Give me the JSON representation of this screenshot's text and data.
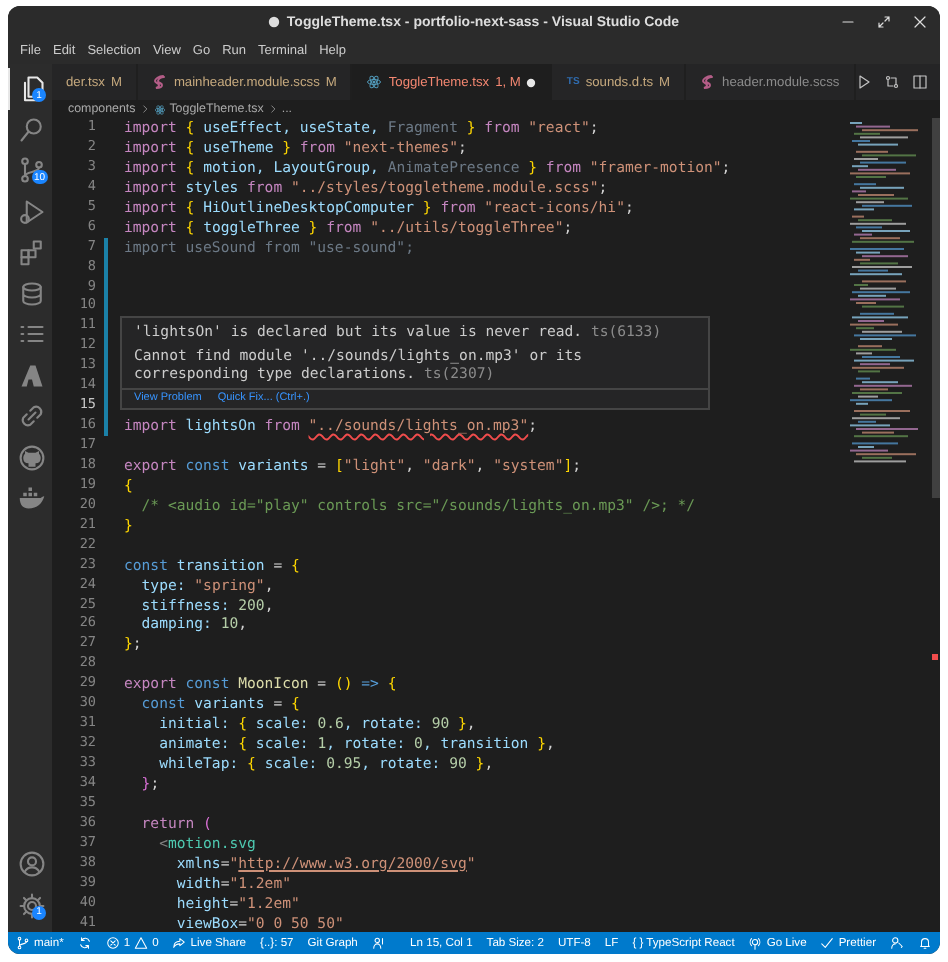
{
  "window": {
    "title": "ToggleTheme.tsx - portfolio-next-sass - Visual Studio Code",
    "dirty": true
  },
  "menu": [
    "File",
    "Edit",
    "Selection",
    "View",
    "Go",
    "Run",
    "Terminal",
    "Help"
  ],
  "activity_bar": {
    "items": [
      {
        "selected": true,
        "badge": "1"
      },
      {
        "selected": false
      },
      {
        "selected": false,
        "badge": "10"
      },
      {
        "selected": false
      },
      {
        "selected": false
      },
      {
        "selected": false
      },
      {
        "selected": false
      },
      {
        "selected": false
      },
      {
        "selected": false
      },
      {
        "selected": false
      },
      {
        "selected": false
      }
    ],
    "bottom_items": [
      {
        "selected": false
      },
      {
        "selected": false,
        "badge": "1"
      }
    ]
  },
  "tabs": [
    {
      "label": "der.tsx",
      "status": "M",
      "has_error": false,
      "selected": false,
      "dirty": false
    },
    {
      "label": "mainheader.module.scss",
      "kind": "sass",
      "status": "M",
      "has_error": false,
      "selected": false,
      "dirty": false
    },
    {
      "label": "ToggleTheme.tsx",
      "kind": "react",
      "status": "1, M",
      "has_error": true,
      "selected": true,
      "dirty": true
    },
    {
      "label": "sounds.d.ts",
      "kind": "typescript",
      "icon_text": "TS",
      "status": "M",
      "has_error": false,
      "selected": false,
      "dirty": false
    },
    {
      "label": "header.module.scss",
      "kind": "sass",
      "has_error": false,
      "selected": false,
      "dirty": false
    }
  ],
  "breadcrumb": [
    {
      "label": "components"
    },
    {
      "label": "ToggleTheme.tsx",
      "kind": "react"
    },
    {
      "label": "..."
    }
  ],
  "editor": {
    "lines": [
      {
        "number": "1",
        "modified": false,
        "current": false,
        "tokens": [
          {
            "text": "import ",
            "kind": "kw"
          },
          {
            "text": "{",
            "kind": "br"
          },
          {
            "text": " useEffect, useState, ",
            "kind": "var"
          },
          {
            "text": "Fragment ",
            "kind": "unused"
          },
          {
            "text": "}",
            "kind": "br"
          },
          {
            "text": " from ",
            "kind": "kw"
          },
          {
            "text": "\"react\"",
            "kind": "str"
          },
          {
            "text": ";",
            "kind": "p"
          }
        ]
      },
      {
        "number": "2",
        "modified": false,
        "current": false,
        "tokens": [
          {
            "text": "import ",
            "kind": "kw"
          },
          {
            "text": "{",
            "kind": "br"
          },
          {
            "text": " useTheme ",
            "kind": "var"
          },
          {
            "text": "}",
            "kind": "br"
          },
          {
            "text": " from ",
            "kind": "kw"
          },
          {
            "text": "\"next-themes\"",
            "kind": "str"
          },
          {
            "text": ";",
            "kind": "p"
          }
        ]
      },
      {
        "number": "3",
        "modified": false,
        "current": false,
        "tokens": [
          {
            "text": "import ",
            "kind": "kw"
          },
          {
            "text": "{",
            "kind": "br"
          },
          {
            "text": " motion, LayoutGroup, ",
            "kind": "var"
          },
          {
            "text": "AnimatePresence ",
            "kind": "unused"
          },
          {
            "text": "}",
            "kind": "br"
          },
          {
            "text": " from ",
            "kind": "kw"
          },
          {
            "text": "\"framer-motion\"",
            "kind": "str"
          },
          {
            "text": ";",
            "kind": "p"
          }
        ]
      },
      {
        "number": "4",
        "modified": false,
        "current": false,
        "tokens": [
          {
            "text": "import",
            "kind": "kw"
          },
          {
            "text": " styles",
            "kind": "var"
          },
          {
            "text": " from ",
            "kind": "kw"
          },
          {
            "text": "\"../styles/toggletheme.module.scss\"",
            "kind": "str"
          },
          {
            "text": ";",
            "kind": "p"
          }
        ]
      },
      {
        "number": "5",
        "modified": false,
        "current": false,
        "tokens": [
          {
            "text": "import ",
            "kind": "kw"
          },
          {
            "text": "{",
            "kind": "br"
          },
          {
            "text": " HiOutlineDesktopComputer ",
            "kind": "var"
          },
          {
            "text": "}",
            "kind": "br"
          },
          {
            "text": " from ",
            "kind": "kw"
          },
          {
            "text": "\"react-icons/hi\"",
            "kind": "str"
          },
          {
            "text": ";",
            "kind": "p"
          }
        ]
      },
      {
        "number": "6",
        "modified": false,
        "current": false,
        "tokens": [
          {
            "text": "import ",
            "kind": "kw"
          },
          {
            "text": "{",
            "kind": "br"
          },
          {
            "text": " toggleThree ",
            "kind": "var"
          },
          {
            "text": "}",
            "kind": "br"
          },
          {
            "text": " from ",
            "kind": "kw"
          },
          {
            "text": "\"../utils/toggleThree\"",
            "kind": "str"
          },
          {
            "text": ";",
            "kind": "p"
          }
        ]
      },
      {
        "number": "7",
        "modified": true,
        "current": false,
        "tokens": [
          {
            "text": "import useSound from \"use-sound\";",
            "kind": "unused"
          }
        ]
      },
      {
        "number": "8",
        "modified": true,
        "current": false
      },
      {
        "number": "9",
        "modified": true,
        "current": false
      },
      {
        "number": "10",
        "modified": true,
        "current": false
      },
      {
        "number": "11",
        "modified": true,
        "current": false
      },
      {
        "number": "12",
        "modified": true,
        "current": false
      },
      {
        "number": "13",
        "modified": true,
        "current": false
      },
      {
        "number": "14",
        "modified": true,
        "current": false
      },
      {
        "number": "15",
        "modified": true,
        "current": true
      },
      {
        "number": "16",
        "modified": true,
        "current": false,
        "tokens": [
          {
            "text": "import",
            "kind": "kw"
          },
          {
            "text": " lightsOn",
            "kind": "var"
          },
          {
            "text": " from ",
            "kind": "kw"
          },
          {
            "text": "\"../sounds/lights_on.mp3\"",
            "kind": "err"
          },
          {
            "text": ";",
            "kind": "p"
          }
        ]
      },
      {
        "number": "17",
        "modified": false,
        "current": false
      },
      {
        "number": "18",
        "modified": false,
        "current": false,
        "tokens": [
          {
            "text": "export",
            "kind": "kw"
          },
          {
            "text": " const",
            "kind": "decl"
          },
          {
            "text": " variants",
            "kind": "var"
          },
          {
            "text": " = ",
            "kind": "p"
          },
          {
            "text": "[",
            "kind": "br"
          },
          {
            "text": "\"light\"",
            "kind": "str"
          },
          {
            "text": ", ",
            "kind": "p"
          },
          {
            "text": "\"dark\"",
            "kind": "str"
          },
          {
            "text": ", ",
            "kind": "p"
          },
          {
            "text": "\"system\"",
            "kind": "str"
          },
          {
            "text": "]",
            "kind": "br"
          },
          {
            "text": ";",
            "kind": "p"
          }
        ]
      },
      {
        "number": "19",
        "modified": false,
        "current": false,
        "tokens": [
          {
            "text": "{",
            "kind": "br"
          }
        ]
      },
      {
        "number": "20",
        "modified": false,
        "current": false,
        "tokens": [
          {
            "text": "  /* <audio id=\"play\" controls src=\"/sounds/lights_on.mp3\" />; */",
            "kind": "com"
          }
        ]
      },
      {
        "number": "21",
        "modified": false,
        "current": false,
        "tokens": [
          {
            "text": "}",
            "kind": "br"
          }
        ]
      },
      {
        "number": "22",
        "modified": false,
        "current": false
      },
      {
        "number": "23",
        "modified": false,
        "current": false,
        "tokens": [
          {
            "text": "const",
            "kind": "decl"
          },
          {
            "text": " transition",
            "kind": "var"
          },
          {
            "text": " = ",
            "kind": "p"
          },
          {
            "text": "{",
            "kind": "br"
          }
        ]
      },
      {
        "number": "24",
        "modified": false,
        "current": false,
        "tokens": [
          {
            "text": "  type: ",
            "kind": "var"
          },
          {
            "text": "\"spring\"",
            "kind": "str"
          },
          {
            "text": ",",
            "kind": "p"
          }
        ]
      },
      {
        "number": "25",
        "modified": false,
        "current": false,
        "tokens": [
          {
            "text": "  stiffness: ",
            "kind": "var"
          },
          {
            "text": "200",
            "kind": "num"
          },
          {
            "text": ",",
            "kind": "p"
          }
        ]
      },
      {
        "number": "26",
        "modified": false,
        "current": false,
        "tokens": [
          {
            "text": "  damping: ",
            "kind": "var"
          },
          {
            "text": "10",
            "kind": "num"
          },
          {
            "text": ",",
            "kind": "p"
          }
        ]
      },
      {
        "number": "27",
        "modified": false,
        "current": false,
        "tokens": [
          {
            "text": "}",
            "kind": "br"
          },
          {
            "text": ";",
            "kind": "p"
          }
        ]
      },
      {
        "number": "28",
        "modified": false,
        "current": false
      },
      {
        "number": "29",
        "modified": false,
        "current": false,
        "tokens": [
          {
            "text": "export",
            "kind": "kw"
          },
          {
            "text": " const",
            "kind": "decl"
          },
          {
            "text": " MoonIcon",
            "kind": "func"
          },
          {
            "text": " = ",
            "kind": "p"
          },
          {
            "text": "()",
            "kind": "br"
          },
          {
            "text": " => ",
            "kind": "decl"
          },
          {
            "text": "{",
            "kind": "br"
          }
        ]
      },
      {
        "number": "30",
        "modified": false,
        "current": false,
        "tokens": [
          {
            "text": "  const",
            "kind": "decl"
          },
          {
            "text": " variants",
            "kind": "var"
          },
          {
            "text": " = ",
            "kind": "p"
          },
          {
            "text": "{",
            "kind": "br"
          }
        ]
      },
      {
        "number": "31",
        "modified": false,
        "current": false,
        "tokens": [
          {
            "text": "    initial: ",
            "kind": "var"
          },
          {
            "text": "{",
            "kind": "br"
          },
          {
            "text": " scale: ",
            "kind": "var"
          },
          {
            "text": "0.6",
            "kind": "num"
          },
          {
            "text": ", rotate: ",
            "kind": "var"
          },
          {
            "text": "90",
            "kind": "num"
          },
          {
            "text": " }",
            "kind": "br"
          },
          {
            "text": ",",
            "kind": "p"
          }
        ]
      },
      {
        "number": "32",
        "modified": false,
        "current": false,
        "tokens": [
          {
            "text": "    animate: ",
            "kind": "var"
          },
          {
            "text": "{",
            "kind": "br"
          },
          {
            "text": " scale: ",
            "kind": "var"
          },
          {
            "text": "1",
            "kind": "num"
          },
          {
            "text": ", rotate: ",
            "kind": "var"
          },
          {
            "text": "0",
            "kind": "num"
          },
          {
            "text": ", transition ",
            "kind": "var"
          },
          {
            "text": "}",
            "kind": "br"
          },
          {
            "text": ",",
            "kind": "p"
          }
        ]
      },
      {
        "number": "33",
        "modified": false,
        "current": false,
        "tokens": [
          {
            "text": "    whileTap: ",
            "kind": "var"
          },
          {
            "text": "{",
            "kind": "br"
          },
          {
            "text": " scale: ",
            "kind": "var"
          },
          {
            "text": "0.95",
            "kind": "num"
          },
          {
            "text": ", rotate: ",
            "kind": "var"
          },
          {
            "text": "90",
            "kind": "num"
          },
          {
            "text": " }",
            "kind": "br"
          },
          {
            "text": ",",
            "kind": "p"
          }
        ]
      },
      {
        "number": "34",
        "modified": false,
        "current": false,
        "tokens": [
          {
            "text": "  }",
            "kind": "br2"
          },
          {
            "text": ";",
            "kind": "p"
          }
        ]
      },
      {
        "number": "35",
        "modified": false,
        "current": false
      },
      {
        "number": "36",
        "modified": false,
        "current": false,
        "tokens": [
          {
            "text": "  return",
            "kind": "kw"
          },
          {
            "text": " (",
            "kind": "br2"
          }
        ]
      },
      {
        "number": "37",
        "modified": false,
        "current": false,
        "tokens": [
          {
            "text": "    <",
            "kind": "gray"
          },
          {
            "text": "motion.svg",
            "kind": "tag"
          }
        ]
      },
      {
        "number": "38",
        "modified": false,
        "current": false,
        "tokens": [
          {
            "text": "      xmlns",
            "kind": "var"
          },
          {
            "text": "=",
            "kind": "p"
          },
          {
            "text": "\"",
            "kind": "str"
          },
          {
            "text": "http://www.w3.org/2000/svg",
            "kind": "link"
          },
          {
            "text": "\"",
            "kind": "str"
          }
        ]
      },
      {
        "number": "39",
        "modified": false,
        "current": false,
        "tokens": [
          {
            "text": "      width",
            "kind": "var"
          },
          {
            "text": "=",
            "kind": "p"
          },
          {
            "text": "\"1.2em\"",
            "kind": "str"
          }
        ]
      },
      {
        "number": "40",
        "modified": false,
        "current": false,
        "tokens": [
          {
            "text": "      height",
            "kind": "var"
          },
          {
            "text": "=",
            "kind": "p"
          },
          {
            "text": "\"1.2em\"",
            "kind": "str"
          }
        ]
      },
      {
        "number": "41",
        "modified": false,
        "current": false,
        "tokens": [
          {
            "text": "      viewBox",
            "kind": "var"
          },
          {
            "text": "=",
            "kind": "p"
          },
          {
            "text": "\"0 0 50 50\"",
            "kind": "str"
          }
        ]
      }
    ],
    "hover": {
      "messages": [
        {
          "text": "'lightsOn' is declared but its value is never read.",
          "code": "ts(6133)"
        },
        {
          "text": "Cannot find module '../sounds/lights_on.mp3' or its corresponding type declarations.",
          "code": "ts(2307)"
        }
      ],
      "actions": [
        "View Problem",
        "Quick Fix... (Ctrl+.)"
      ]
    }
  },
  "status_bar": {
    "left": [
      {
        "kind": "branch",
        "text": "main*"
      },
      {
        "kind": "sync"
      },
      {
        "kind": "problems",
        "errors": "1",
        "warnings": "0"
      },
      {
        "kind": "live-share",
        "text": "Live Share"
      },
      {
        "kind": "text",
        "text": "{..}: 57"
      },
      {
        "kind": "text",
        "text": "Git Graph"
      },
      {
        "kind": "person"
      }
    ],
    "right": [
      {
        "kind": "text",
        "text": "Ln 15, Col 1"
      },
      {
        "kind": "text",
        "text": "Tab Size: 2"
      },
      {
        "kind": "text",
        "text": "UTF-8"
      },
      {
        "kind": "text",
        "text": "LF"
      },
      {
        "kind": "language",
        "text": "{ } TypeScript React"
      },
      {
        "kind": "go-live",
        "text": "Go Live"
      },
      {
        "kind": "check",
        "text": "Prettier"
      },
      {
        "kind": "feedback"
      },
      {
        "kind": "bell"
      }
    ]
  }
}
